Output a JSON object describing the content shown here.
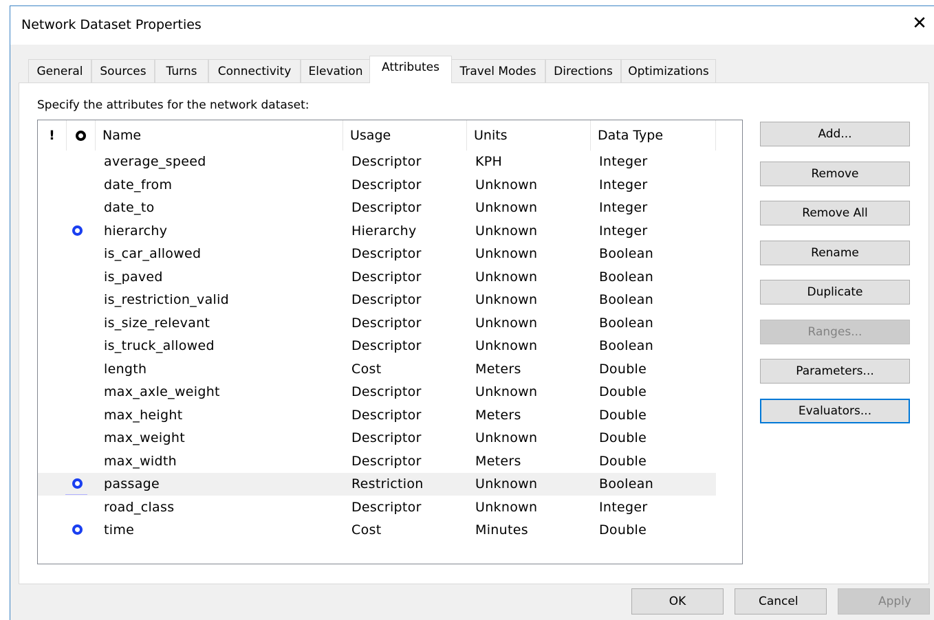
{
  "window": {
    "title": "Network Dataset Properties",
    "close_glyph": "✕"
  },
  "tabs": [
    {
      "label": "General"
    },
    {
      "label": "Sources"
    },
    {
      "label": "Turns"
    },
    {
      "label": "Connectivity"
    },
    {
      "label": "Elevation"
    },
    {
      "label": "Attributes",
      "active": true
    },
    {
      "label": "Travel Modes"
    },
    {
      "label": "Directions"
    },
    {
      "label": "Optimizations"
    }
  ],
  "attributes_page": {
    "prompt": "Specify the attributes for the network dataset:",
    "columns": {
      "warning": "!",
      "evaluator_icon": "evaluator-icon",
      "name": "Name",
      "usage": "Usage",
      "units": "Units",
      "data_type": "Data Type"
    },
    "rows": [
      {
        "default": false,
        "name": "average_speed",
        "usage": "Descriptor",
        "units": "KPH",
        "data_type": "Integer"
      },
      {
        "default": false,
        "name": "date_from",
        "usage": "Descriptor",
        "units": "Unknown",
        "data_type": "Integer"
      },
      {
        "default": false,
        "name": "date_to",
        "usage": "Descriptor",
        "units": "Unknown",
        "data_type": "Integer"
      },
      {
        "default": true,
        "name": "hierarchy",
        "usage": "Hierarchy",
        "units": "Unknown",
        "data_type": "Integer"
      },
      {
        "default": false,
        "name": "is_car_allowed",
        "usage": "Descriptor",
        "units": "Unknown",
        "data_type": "Boolean"
      },
      {
        "default": false,
        "name": "is_paved",
        "usage": "Descriptor",
        "units": "Unknown",
        "data_type": "Boolean"
      },
      {
        "default": false,
        "name": "is_restriction_valid",
        "usage": "Descriptor",
        "units": "Unknown",
        "data_type": "Boolean"
      },
      {
        "default": false,
        "name": "is_size_relevant",
        "usage": "Descriptor",
        "units": "Unknown",
        "data_type": "Boolean"
      },
      {
        "default": false,
        "name": "is_truck_allowed",
        "usage": "Descriptor",
        "units": "Unknown",
        "data_type": "Boolean"
      },
      {
        "default": false,
        "name": "length",
        "usage": "Cost",
        "units": "Meters",
        "data_type": "Double"
      },
      {
        "default": false,
        "name": "max_axle_weight",
        "usage": "Descriptor",
        "units": "Unknown",
        "data_type": "Double"
      },
      {
        "default": false,
        "name": "max_height",
        "usage": "Descriptor",
        "units": "Meters",
        "data_type": "Double"
      },
      {
        "default": false,
        "name": "max_weight",
        "usage": "Descriptor",
        "units": "Unknown",
        "data_type": "Double"
      },
      {
        "default": false,
        "name": "max_width",
        "usage": "Descriptor",
        "units": "Meters",
        "data_type": "Double"
      },
      {
        "default": true,
        "selected": true,
        "name": "passage",
        "usage": "Restriction",
        "units": "Unknown",
        "data_type": "Boolean"
      },
      {
        "default": false,
        "name": "road_class",
        "usage": "Descriptor",
        "units": "Unknown",
        "data_type": "Integer"
      },
      {
        "default": true,
        "name": "time",
        "usage": "Cost",
        "units": "Minutes",
        "data_type": "Double"
      }
    ],
    "side_buttons": [
      {
        "label": "Add...",
        "enabled": true
      },
      {
        "label": "Remove",
        "enabled": true
      },
      {
        "label": "Remove All",
        "enabled": true
      },
      {
        "label": "Rename",
        "enabled": true
      },
      {
        "label": "Duplicate",
        "enabled": true
      },
      {
        "label": "Ranges...",
        "enabled": false
      },
      {
        "label": "Parameters...",
        "enabled": true
      },
      {
        "label": "Evaluators...",
        "enabled": true,
        "focused": true
      }
    ]
  },
  "footer": {
    "ok": "OK",
    "cancel": "Cancel",
    "apply": "Apply",
    "apply_enabled": false
  },
  "colors": {
    "evaluator_icon": "#1a3ff0",
    "focus_border": "#0078d7",
    "selection_row": "#f0f0f0"
  }
}
